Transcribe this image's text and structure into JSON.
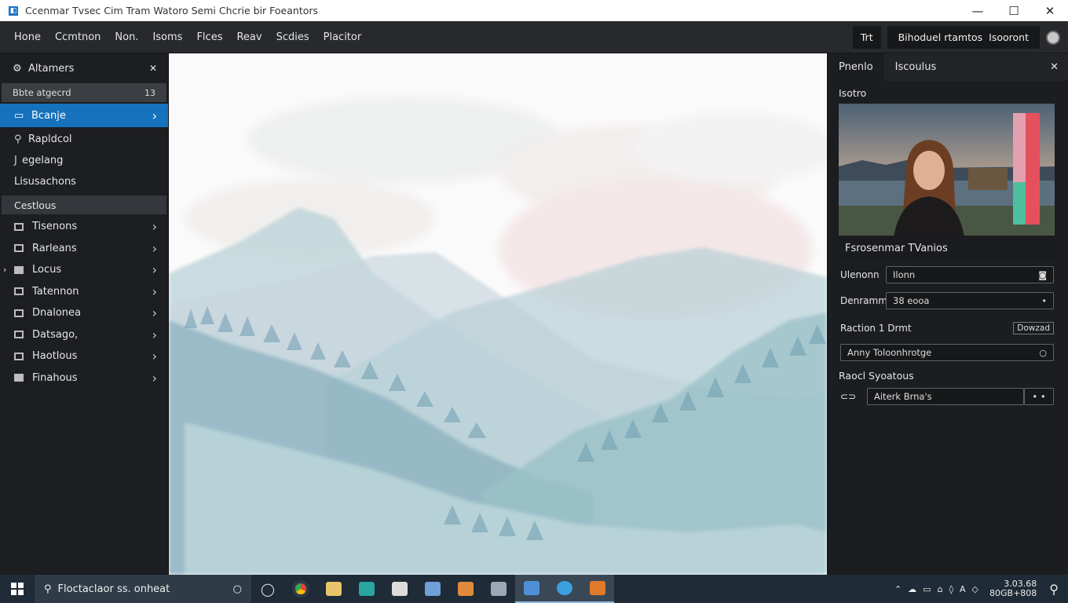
{
  "window": {
    "title": "Ccenmar Tvsec Cim Tram Watoro Semi Chcrie bir Foeantors",
    "controls": [
      "—",
      "☐",
      "✕"
    ]
  },
  "menubar": {
    "items": [
      "Hone",
      "Ccmtnon",
      "Non.",
      "Isoms",
      "Flces",
      "Reav",
      "Scdies",
      "Placitor"
    ],
    "right_button": "Trt",
    "right_labels": [
      "Bihoduel rtamtos",
      "Isooront"
    ]
  },
  "sidebar": {
    "header": "Altamers",
    "sub_label": "Bbte atgecrd",
    "sub_count": "13",
    "active_item": "Bcanje",
    "items": [
      "Rapldcol",
      "egelang",
      "Lisusachons"
    ],
    "section": "Cestlous",
    "nav": [
      "Tisenons",
      "Rarleans",
      "Locus",
      "Tatennon",
      "Dnalonea",
      "Datsago,",
      "Haotlous",
      "Finahous"
    ]
  },
  "right_panel": {
    "tabs": [
      "Pnenlo",
      "Iscoulus"
    ],
    "section_label": "Isotro",
    "preview_caption": "Fsrosenmar TVanios",
    "fields": [
      {
        "label": "Ulenonn",
        "value": "Ilonn"
      },
      {
        "label": "Denrammi",
        "value": "38 eooa"
      }
    ],
    "row_label": "Raction 1 Drmt",
    "row_button": "Dowzad",
    "search_value": "Anny Toloonhrotge",
    "section2": "Raocl Syoatous",
    "input2_value": "Aiterk Brna's",
    "input2_btn": "• •"
  },
  "taskbar": {
    "search_text": "Floctaclaor ss. onheat",
    "clock_time": "3.03.68",
    "clock_date": "80GB+808"
  },
  "colors": {
    "accent": "#1672bd",
    "window_bg": "#1e2022",
    "taskbar_bg": "#1f2b36"
  }
}
